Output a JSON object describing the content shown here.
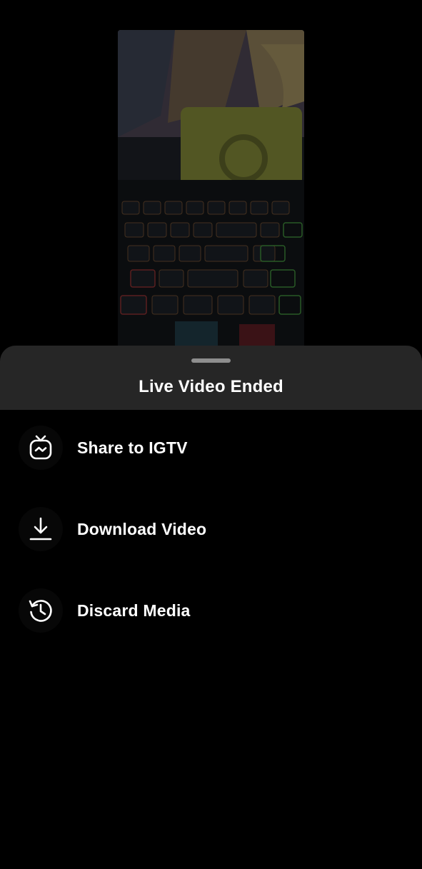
{
  "preview": {
    "description_icon": "video-thumbnail"
  },
  "sheet": {
    "title": "Live Video Ended",
    "options": [
      {
        "label": "Share to IGTV",
        "icon": "igtv-icon"
      },
      {
        "label": "Download Video",
        "icon": "download-icon"
      },
      {
        "label": "Discard Media",
        "icon": "history-icon"
      }
    ]
  },
  "colors": {
    "sheet_header_bg": "#262626",
    "background": "#000000",
    "grabber": "#8e8e8e",
    "text": "#ffffff"
  }
}
